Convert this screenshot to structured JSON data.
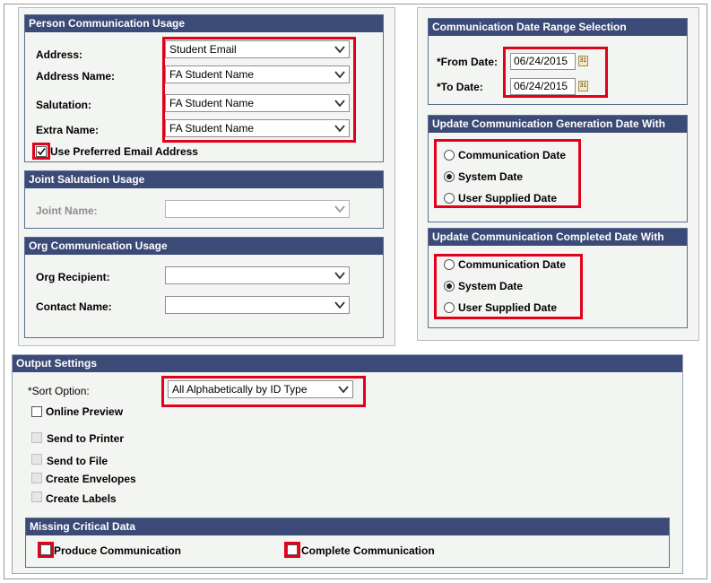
{
  "person_comm": {
    "title": "Person Communication Usage",
    "address_label": "Address:",
    "address_value": "Student Email",
    "address_name_label": "Address Name:",
    "address_name_value": "FA Student Name",
    "salutation_label": "Salutation:",
    "salutation_value": "FA Student Name",
    "extra_name_label": "Extra Name:",
    "extra_name_value": "FA Student Name",
    "preferred_email_label": "Use Preferred Email Address",
    "preferred_email_checked": true
  },
  "joint": {
    "title": "Joint Salutation Usage",
    "joint_name_label": "Joint Name:",
    "joint_name_value": ""
  },
  "org_comm": {
    "title": "Org Communication Usage",
    "org_recipient_label": "Org Recipient:",
    "org_recipient_value": "",
    "contact_name_label": "Contact Name:",
    "contact_name_value": ""
  },
  "date_range": {
    "title": "Communication Date Range Selection",
    "from_label": "*From Date:",
    "from_value": "06/24/2015",
    "to_label": "*To Date:",
    "to_value": "06/24/2015",
    "calendar_glyph": "31"
  },
  "gen_date": {
    "title": "Update Communication Generation Date With",
    "options": [
      "Communication Date",
      "System Date",
      "User Supplied Date"
    ],
    "selected": "System Date"
  },
  "completed_date": {
    "title": "Update Communication Completed Date With",
    "options": [
      "Communication Date",
      "System Date",
      "User Supplied Date"
    ],
    "selected": "System Date"
  },
  "output": {
    "title": "Output Settings",
    "sort_label": "*Sort Option:",
    "sort_value": "All Alphabetically by ID Type",
    "online_preview": "Online Preview",
    "send_to_printer": "Send to Printer",
    "send_to_file": "Send to File",
    "create_envelopes": "Create Envelopes",
    "create_labels": "Create Labels"
  },
  "missing": {
    "title": "Missing Critical Data",
    "produce": "Produce Communication",
    "complete": "Complete Communication"
  },
  "colors": {
    "header_bg": "#3b4a76",
    "panel_bg": "#f3f5f2",
    "highlight": "#e2001a"
  },
  "icons": {
    "dropdown": "chevron-down-icon",
    "calendar": "calendar-icon",
    "checkmark": "checkmark-icon"
  }
}
